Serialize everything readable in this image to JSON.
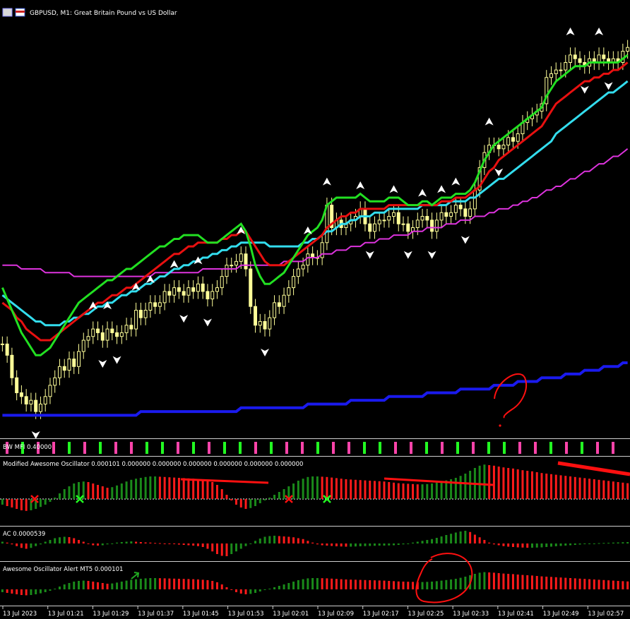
{
  "header": {
    "title": "GBPUSD, M1:  Great Britain Pound vs US Dollar"
  },
  "panels": {
    "bwmfi_label": "BW MFI 0.40000",
    "mao_label": "Modified Awesome Oscillator 0.000101 0.000000 0.000000 0.000000 0.000000 0.000000 0.000000",
    "ac_label": "AC 0.0000539",
    "aoa_label": "Awesome Oscillator Alert MT5 0.000101"
  },
  "colors": {
    "background": "#000000",
    "candle": "#ffff99",
    "fast_ma": "#22e022",
    "mid_ma": "#e81010",
    "slow_ma": "#33ddee",
    "ma_magenta": "#dd33dd",
    "ma_blue": "#1a1aee",
    "up_bar": "#1a8a1a",
    "down_bar": "#ff1a1a",
    "mfi_green": "#22ff22",
    "mfi_pink": "#ff44aa",
    "annotation": "#ff1010"
  },
  "chart_data": {
    "type": "line",
    "instrument": "GBPUSD",
    "timeframe": "M1",
    "x_ticks": [
      "13 Jul 2023",
      "13 Jul 01:21",
      "13 Jul 01:29",
      "13 Jul 01:37",
      "13 Jul 01:45",
      "13 Jul 01:53",
      "13 Jul 02:01",
      "13 Jul 02:09",
      "13 Jul 02:17",
      "13 Jul 02:25",
      "13 Jul 02:33",
      "13 Jul 02:41",
      "13 Jul 02:49",
      "13 Jul 02:57"
    ],
    "price_close": [
      0.49,
      0.46,
      0.4,
      0.36,
      0.35,
      0.33,
      0.34,
      0.31,
      0.33,
      0.35,
      0.38,
      0.4,
      0.43,
      0.42,
      0.45,
      0.43,
      0.47,
      0.5,
      0.51,
      0.53,
      0.52,
      0.5,
      0.53,
      0.52,
      0.51,
      0.52,
      0.54,
      0.53,
      0.58,
      0.56,
      0.58,
      0.6,
      0.59,
      0.6,
      0.63,
      0.62,
      0.64,
      0.63,
      0.62,
      0.64,
      0.63,
      0.65,
      0.63,
      0.61,
      0.63,
      0.64,
      0.67,
      0.7,
      0.7,
      0.71,
      0.73,
      0.69,
      0.59,
      0.54,
      0.55,
      0.53,
      0.56,
      0.6,
      0.59,
      0.62,
      0.64,
      0.67,
      0.69,
      0.7,
      0.73,
      0.72,
      0.72,
      0.76,
      0.86,
      0.8,
      0.82,
      0.8,
      0.81,
      0.82,
      0.83,
      0.85,
      0.81,
      0.79,
      0.81,
      0.82,
      0.82,
      0.83,
      0.84,
      0.81,
      0.81,
      0.79,
      0.8,
      0.82,
      0.83,
      0.82,
      0.79,
      0.82,
      0.84,
      0.83,
      0.84,
      0.86,
      0.85,
      0.83,
      0.85,
      0.9,
      0.96,
      1,
      1.02,
      1.02,
      1.01,
      1.02,
      1.04,
      1.03,
      1.05,
      1.08,
      1.09,
      1.1,
      1.11,
      1.13,
      1.2,
      1.21,
      1.22,
      1.22,
      1.24,
      1.26,
      1.25,
      1.24,
      1.23,
      1.25,
      1.24,
      1.26,
      1.25,
      1.24,
      1.25,
      1.24,
      1.27,
      1.28
    ],
    "ma_fast_green": [
      0.64,
      0.61,
      0.58,
      0.55,
      0.52,
      0.5,
      0.48,
      0.46,
      0.46,
      0.47,
      0.48,
      0.5,
      0.52,
      0.54,
      0.56,
      0.58,
      0.6,
      0.61,
      0.62,
      0.63,
      0.64,
      0.65,
      0.66,
      0.66,
      0.67,
      0.68,
      0.69,
      0.69,
      0.7,
      0.71,
      0.72,
      0.73,
      0.74,
      0.75,
      0.75,
      0.76,
      0.77,
      0.77,
      0.78,
      0.78,
      0.78,
      0.78,
      0.77,
      0.76,
      0.76,
      0.76,
      0.77,
      0.78,
      0.79,
      0.8,
      0.81,
      0.79,
      0.75,
      0.7,
      0.67,
      0.65,
      0.65,
      0.66,
      0.67,
      0.68,
      0.7,
      0.72,
      0.74,
      0.76,
      0.78,
      0.79,
      0.8,
      0.82,
      0.86,
      0.87,
      0.88,
      0.88,
      0.88,
      0.88,
      0.88,
      0.89,
      0.88,
      0.87,
      0.87,
      0.87,
      0.87,
      0.88,
      0.88,
      0.88,
      0.87,
      0.86,
      0.86,
      0.86,
      0.87,
      0.87,
      0.86,
      0.87,
      0.88,
      0.88,
      0.88,
      0.89,
      0.89,
      0.89,
      0.9,
      0.92,
      0.95,
      0.98,
      1,
      1.02,
      1.03,
      1.04,
      1.05,
      1.06,
      1.07,
      1.08,
      1.09,
      1.1,
      1.11,
      1.12,
      1.15,
      1.17,
      1.19,
      1.2,
      1.21,
      1.22,
      1.23,
      1.23,
      1.23,
      1.24,
      1.24,
      1.24,
      1.24,
      1.24,
      1.24,
      1.24,
      1.25,
      1.26
    ],
    "ma_mid_red": [
      0.6,
      0.59,
      0.58,
      0.56,
      0.55,
      0.53,
      0.52,
      0.51,
      0.5,
      0.5,
      0.5,
      0.51,
      0.52,
      0.53,
      0.54,
      0.55,
      0.56,
      0.57,
      0.58,
      0.59,
      0.6,
      0.6,
      0.61,
      0.62,
      0.62,
      0.63,
      0.64,
      0.64,
      0.65,
      0.66,
      0.67,
      0.68,
      0.69,
      0.7,
      0.71,
      0.72,
      0.73,
      0.73,
      0.74,
      0.75,
      0.75,
      0.76,
      0.76,
      0.76,
      0.76,
      0.76,
      0.77,
      0.77,
      0.78,
      0.78,
      0.79,
      0.79,
      0.77,
      0.75,
      0.73,
      0.71,
      0.7,
      0.7,
      0.7,
      0.7,
      0.71,
      0.72,
      0.73,
      0.74,
      0.75,
      0.76,
      0.77,
      0.78,
      0.8,
      0.81,
      0.82,
      0.83,
      0.83,
      0.84,
      0.84,
      0.85,
      0.85,
      0.85,
      0.85,
      0.85,
      0.85,
      0.86,
      0.86,
      0.86,
      0.86,
      0.86,
      0.86,
      0.86,
      0.86,
      0.86,
      0.86,
      0.86,
      0.87,
      0.87,
      0.87,
      0.88,
      0.88,
      0.88,
      0.89,
      0.9,
      0.91,
      0.93,
      0.95,
      0.96,
      0.98,
      0.99,
      1,
      1.01,
      1.02,
      1.03,
      1.04,
      1.05,
      1.06,
      1.07,
      1.09,
      1.11,
      1.13,
      1.14,
      1.15,
      1.16,
      1.17,
      1.18,
      1.19,
      1.19,
      1.2,
      1.2,
      1.21,
      1.21,
      1.22,
      1.22,
      1.23,
      1.24
    ],
    "ma_slow_cyan": [
      0.62,
      0.61,
      0.6,
      0.59,
      0.58,
      0.57,
      0.56,
      0.55,
      0.55,
      0.54,
      0.54,
      0.54,
      0.54,
      0.55,
      0.55,
      0.56,
      0.56,
      0.57,
      0.57,
      0.58,
      0.59,
      0.59,
      0.6,
      0.6,
      0.61,
      0.62,
      0.62,
      0.63,
      0.63,
      0.64,
      0.65,
      0.65,
      0.66,
      0.67,
      0.67,
      0.68,
      0.69,
      0.69,
      0.7,
      0.7,
      0.71,
      0.71,
      0.72,
      0.72,
      0.73,
      0.73,
      0.74,
      0.74,
      0.75,
      0.75,
      0.76,
      0.76,
      0.76,
      0.76,
      0.76,
      0.76,
      0.75,
      0.75,
      0.75,
      0.75,
      0.75,
      0.75,
      0.75,
      0.76,
      0.76,
      0.77,
      0.77,
      0.78,
      0.79,
      0.79,
      0.8,
      0.81,
      0.81,
      0.82,
      0.82,
      0.83,
      0.83,
      0.83,
      0.84,
      0.84,
      0.84,
      0.85,
      0.85,
      0.85,
      0.85,
      0.85,
      0.85,
      0.85,
      0.86,
      0.86,
      0.86,
      0.86,
      0.86,
      0.86,
      0.87,
      0.87,
      0.87,
      0.87,
      0.88,
      0.88,
      0.89,
      0.9,
      0.91,
      0.92,
      0.93,
      0.93,
      0.94,
      0.95,
      0.96,
      0.97,
      0.98,
      0.99,
      1,
      1.01,
      1.02,
      1.03,
      1.05,
      1.06,
      1.07,
      1.08,
      1.09,
      1.1,
      1.11,
      1.12,
      1.13,
      1.14,
      1.15,
      1.16,
      1.16,
      1.17,
      1.18,
      1.19
    ],
    "ma_magenta": [
      0.7,
      0.7,
      0.7,
      0.7,
      0.69,
      0.69,
      0.69,
      0.69,
      0.69,
      0.68,
      0.68,
      0.68,
      0.68,
      0.68,
      0.68,
      0.67,
      0.67,
      0.67,
      0.67,
      0.67,
      0.67,
      0.67,
      0.67,
      0.67,
      0.67,
      0.67,
      0.67,
      0.67,
      0.67,
      0.67,
      0.67,
      0.67,
      0.68,
      0.68,
      0.68,
      0.68,
      0.68,
      0.68,
      0.68,
      0.68,
      0.68,
      0.68,
      0.69,
      0.69,
      0.69,
      0.69,
      0.69,
      0.69,
      0.69,
      0.69,
      0.7,
      0.7,
      0.7,
      0.7,
      0.7,
      0.7,
      0.7,
      0.7,
      0.7,
      0.71,
      0.71,
      0.71,
      0.71,
      0.71,
      0.72,
      0.72,
      0.72,
      0.73,
      0.73,
      0.73,
      0.74,
      0.74,
      0.74,
      0.75,
      0.75,
      0.75,
      0.76,
      0.76,
      0.76,
      0.77,
      0.77,
      0.77,
      0.78,
      0.78,
      0.78,
      0.78,
      0.79,
      0.79,
      0.79,
      0.8,
      0.8,
      0.8,
      0.8,
      0.81,
      0.81,
      0.81,
      0.82,
      0.82,
      0.82,
      0.83,
      0.83,
      0.83,
      0.84,
      0.84,
      0.85,
      0.85,
      0.85,
      0.86,
      0.86,
      0.87,
      0.87,
      0.88,
      0.88,
      0.89,
      0.9,
      0.9,
      0.91,
      0.91,
      0.92,
      0.93,
      0.93,
      0.94,
      0.95,
      0.95,
      0.96,
      0.97,
      0.97,
      0.98,
      0.99,
      0.99,
      1,
      1.01
    ],
    "ma_blue": [
      0.3,
      0.3,
      0.3,
      0.3,
      0.3,
      0.3,
      0.3,
      0.3,
      0.3,
      0.3,
      0.3,
      0.3,
      0.3,
      0.3,
      0.3,
      0.3,
      0.3,
      0.3,
      0.3,
      0.3,
      0.3,
      0.3,
      0.3,
      0.3,
      0.3,
      0.3,
      0.3,
      0.3,
      0.3,
      0.31,
      0.31,
      0.31,
      0.31,
      0.31,
      0.31,
      0.31,
      0.31,
      0.31,
      0.31,
      0.31,
      0.31,
      0.31,
      0.31,
      0.31,
      0.31,
      0.31,
      0.31,
      0.31,
      0.31,
      0.31,
      0.32,
      0.32,
      0.32,
      0.32,
      0.32,
      0.32,
      0.32,
      0.32,
      0.32,
      0.32,
      0.32,
      0.32,
      0.32,
      0.32,
      0.33,
      0.33,
      0.33,
      0.33,
      0.33,
      0.33,
      0.33,
      0.33,
      0.33,
      0.34,
      0.34,
      0.34,
      0.34,
      0.34,
      0.34,
      0.34,
      0.34,
      0.35,
      0.35,
      0.35,
      0.35,
      0.35,
      0.35,
      0.35,
      0.35,
      0.36,
      0.36,
      0.36,
      0.36,
      0.36,
      0.36,
      0.36,
      0.37,
      0.37,
      0.37,
      0.37,
      0.37,
      0.37,
      0.37,
      0.38,
      0.38,
      0.38,
      0.38,
      0.38,
      0.39,
      0.39,
      0.39,
      0.39,
      0.39,
      0.4,
      0.4,
      0.4,
      0.4,
      0.4,
      0.41,
      0.41,
      0.41,
      0.41,
      0.42,
      0.42,
      0.42,
      0.42,
      0.43,
      0.43,
      0.43,
      0.43,
      0.44,
      0.44
    ],
    "ao_values": [
      -0.2,
      -0.25,
      -0.3,
      -0.35,
      -0.4,
      -0.42,
      -0.4,
      -0.35,
      -0.28,
      -0.2,
      -0.1,
      0.05,
      0.2,
      0.35,
      0.45,
      0.55,
      0.6,
      0.62,
      0.6,
      0.55,
      0.5,
      0.45,
      0.4,
      0.42,
      0.48,
      0.55,
      0.62,
      0.68,
      0.72,
      0.75,
      0.78,
      0.8,
      0.8,
      0.79,
      0.78,
      0.77,
      0.76,
      0.75,
      0.74,
      0.73,
      0.72,
      0.7,
      0.68,
      0.65,
      0.6,
      0.5,
      0.35,
      0.15,
      -0.05,
      -0.2,
      -0.3,
      -0.35,
      -0.32,
      -0.25,
      -0.15,
      -0.05,
      0.05,
      0.15,
      0.25,
      0.35,
      0.45,
      0.55,
      0.65,
      0.72,
      0.78,
      0.8,
      0.8,
      0.79,
      0.78,
      0.76,
      0.74,
      0.72,
      0.7,
      0.69,
      0.68,
      0.67,
      0.66,
      0.65,
      0.64,
      0.63,
      0.62,
      0.6,
      0.58,
      0.56,
      0.55,
      0.54,
      0.53,
      0.52,
      0.52,
      0.53,
      0.55,
      0.58,
      0.62,
      0.66,
      0.7,
      0.75,
      0.82,
      0.9,
      1,
      1.1,
      1.18,
      1.22,
      1.2,
      1.18,
      1.15,
      1.12,
      1.1,
      1.08,
      1.05,
      1.02,
      1,
      0.98,
      0.95,
      0.92,
      0.9,
      0.88,
      0.86,
      0.84,
      0.82,
      0.8,
      0.78,
      0.76,
      0.74,
      0.72,
      0.7,
      0.68,
      0.66,
      0.64,
      0.62,
      0.6,
      0.58,
      0.56
    ],
    "ac_values": [
      0.1,
      0.05,
      -0.05,
      -0.15,
      -0.25,
      -0.3,
      -0.25,
      -0.15,
      -0.05,
      0.1,
      0.2,
      0.3,
      0.35,
      0.38,
      0.36,
      0.3,
      0.2,
      0.1,
      0,
      -0.1,
      -0.12,
      -0.1,
      -0.05,
      0,
      0.05,
      0.08,
      0.1,
      0.12,
      0.1,
      0.08,
      0.06,
      0.05,
      0.03,
      0.02,
      0,
      -0.02,
      -0.04,
      -0.06,
      -0.08,
      -0.1,
      -0.12,
      -0.15,
      -0.2,
      -0.3,
      -0.45,
      -0.6,
      -0.7,
      -0.72,
      -0.6,
      -0.45,
      -0.3,
      -0.15,
      0,
      0.15,
      0.28,
      0.38,
      0.42,
      0.44,
      0.42,
      0.4,
      0.38,
      0.35,
      0.3,
      0.25,
      0.15,
      0.05,
      -0.05,
      -0.1,
      -0.12,
      -0.14,
      -0.16,
      -0.17,
      -0.18,
      -0.18,
      -0.17,
      -0.16,
      -0.15,
      -0.14,
      -0.13,
      -0.12,
      -0.12,
      -0.11,
      -0.1,
      -0.08,
      -0.05,
      0,
      0.05,
      0.1,
      0.15,
      0.2,
      0.25,
      0.32,
      0.4,
      0.48,
      0.55,
      0.62,
      0.68,
      0.72,
      0.65,
      0.5,
      0.35,
      0.2,
      0.05,
      -0.05,
      -0.1,
      -0.15,
      -0.18,
      -0.2,
      -0.22,
      -0.23,
      -0.24,
      -0.24,
      -0.23,
      -0.22,
      -0.2,
      -0.18,
      -0.16,
      -0.14,
      -0.12,
      -0.1,
      -0.08,
      -0.06,
      -0.04,
      -0.02,
      0,
      0.02,
      0.03,
      0.04,
      0.05,
      0.06,
      0.07,
      0.08
    ],
    "mfi_colors": [
      "pink",
      "green",
      "pink",
      "pink",
      "green",
      "pink",
      "green",
      "pink",
      "pink",
      "green",
      "green",
      "pink",
      "green",
      "pink",
      "green",
      "green",
      "pink",
      "green",
      "pink",
      "pink",
      "green",
      "pink",
      "pink",
      "green",
      "green",
      "pink",
      "pink",
      "green",
      "pink",
      "green",
      "pink",
      "green",
      "green",
      "pink",
      "pink",
      "green",
      "pink",
      "green",
      "pink",
      "pink"
    ]
  }
}
